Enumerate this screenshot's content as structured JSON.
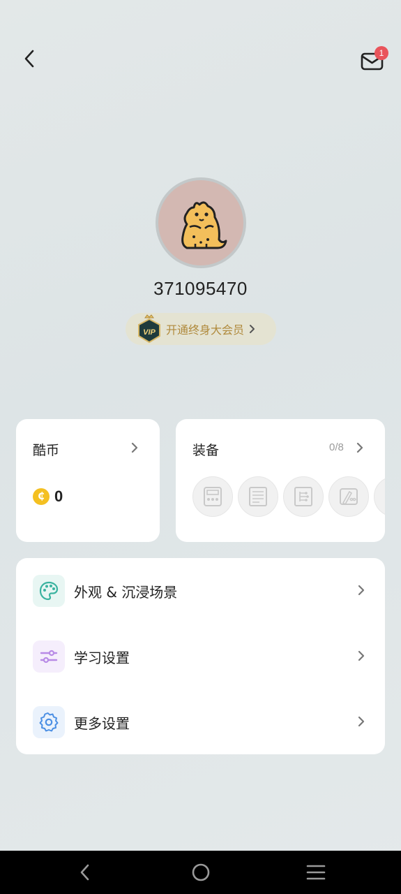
{
  "header": {
    "back_icon": "chevron-left-icon",
    "mail_icon": "mail-icon",
    "mail_badge": "1",
    "badge_color": "#e9545b"
  },
  "profile": {
    "avatar_icon": "hamster-avatar",
    "user_id": "371095470",
    "vip_badge_text": "VIP",
    "vip_cta": "开通终身大会员"
  },
  "coins": {
    "title": "酷币",
    "value": "0",
    "coin_symbol": "₵"
  },
  "equipment": {
    "title": "装备",
    "count": "0/8",
    "slot_icons": [
      "layout-doc-icon",
      "notes-doc-icon",
      "mindmap-icon",
      "pen-infinity-icon",
      "doc-partial-icon"
    ]
  },
  "menu": {
    "items": [
      {
        "label": "外观 & 沉浸场景",
        "icon": "palette-icon",
        "icon_color": "#3bb3a0",
        "icon_bg": "#e8f6f3"
      },
      {
        "label": "学习设置",
        "icon": "sliders-icon",
        "icon_color": "#b88ae6",
        "icon_bg": "#f5eefc"
      },
      {
        "label": "更多设置",
        "icon": "gear-icon",
        "icon_color": "#4b8fe4",
        "icon_bg": "#eaf2fc"
      }
    ]
  },
  "navbar": {
    "back": "nav-back-icon",
    "home": "nav-home-icon",
    "menu": "nav-menu-icon"
  },
  "colors": {
    "accent_gold": "#b08a3c",
    "coin_yellow": "#f4c021"
  }
}
